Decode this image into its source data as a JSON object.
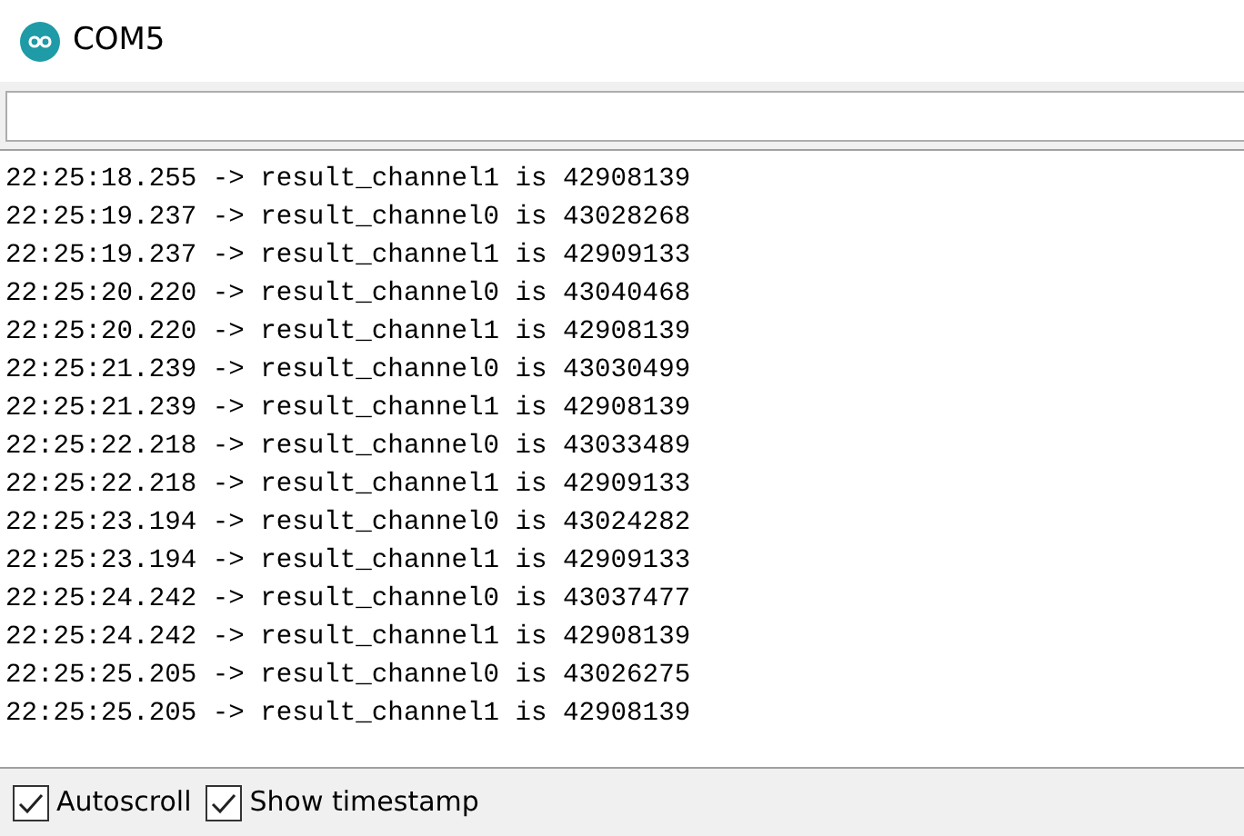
{
  "window": {
    "title": "COM5"
  },
  "output_lines": [
    "22:25:18.255 -> result_channel1 is 42908139",
    "22:25:19.237 -> result_channel0 is 43028268",
    "22:25:19.237 -> result_channel1 is 42909133",
    "22:25:20.220 -> result_channel0 is 43040468",
    "22:25:20.220 -> result_channel1 is 42908139",
    "22:25:21.239 -> result_channel0 is 43030499",
    "22:25:21.239 -> result_channel1 is 42908139",
    "22:25:22.218 -> result_channel0 is 43033489",
    "22:25:22.218 -> result_channel1 is 42909133",
    "22:25:23.194 -> result_channel0 is 43024282",
    "22:25:23.194 -> result_channel1 is 42909133",
    "22:25:24.242 -> result_channel0 is 43037477",
    "22:25:24.242 -> result_channel1 is 42908139",
    "22:25:25.205 -> result_channel0 is 43026275",
    "22:25:25.205 -> result_channel1 is 42908139"
  ],
  "options": [
    {
      "label": "Autoscroll",
      "checked": true
    },
    {
      "label": "Show timestamp",
      "checked": true
    }
  ]
}
